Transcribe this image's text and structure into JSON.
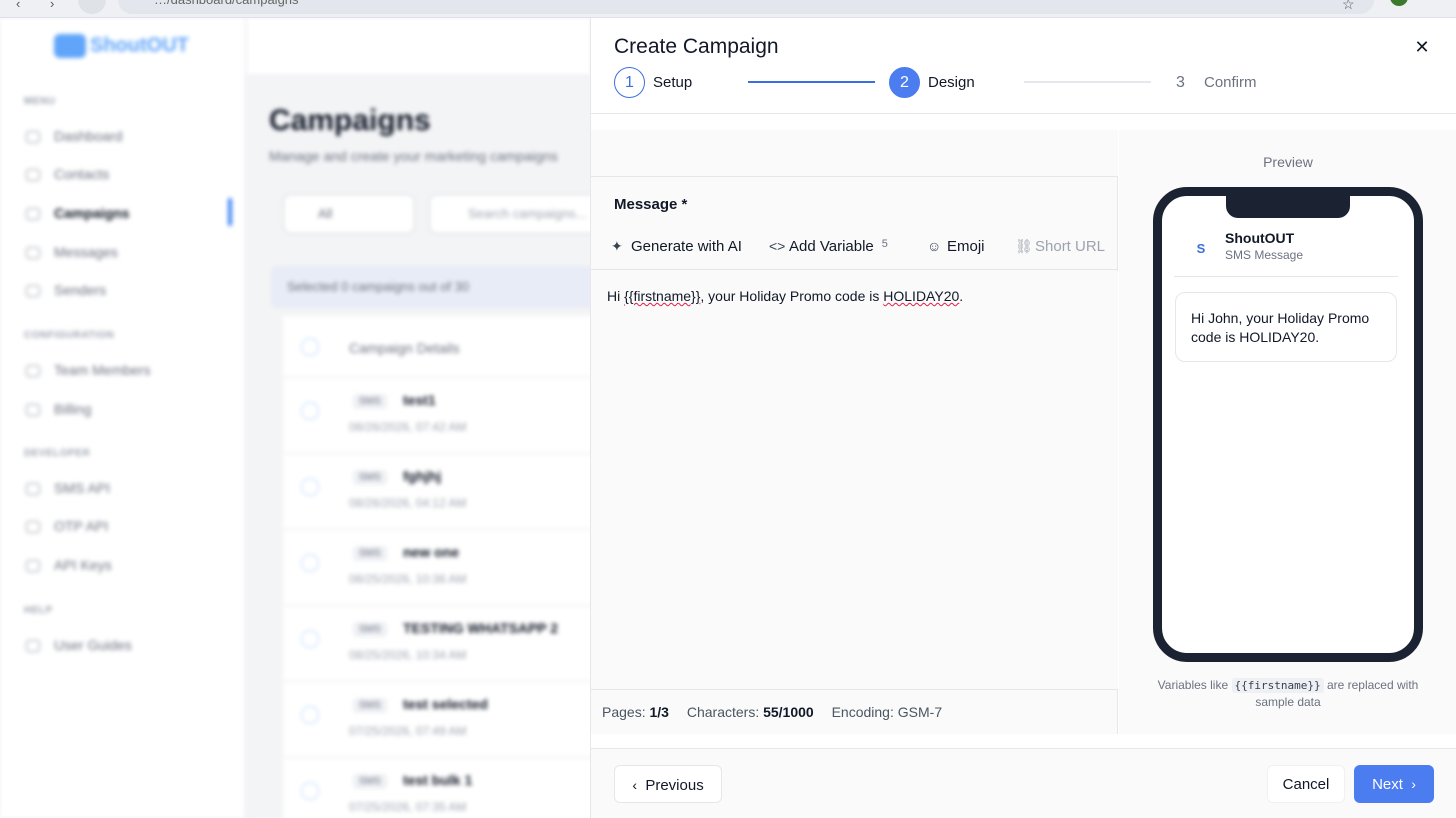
{
  "browser": {
    "url": "…/dashboard/campaigns"
  },
  "background": {
    "logo": "ShoutOUT",
    "sections": [
      "MENU",
      "CONFIGURATION",
      "DEVELOPER",
      "HELP"
    ],
    "nav": {
      "menu": [
        "Dashboard",
        "Contacts",
        "Campaigns",
        "Messages",
        "Senders"
      ],
      "configuration": [
        "Team Members",
        "Billing"
      ],
      "developer": [
        "SMS API",
        "OTP API",
        "API Keys"
      ],
      "help": [
        "User Guides"
      ]
    },
    "page_title": "Campaigns",
    "page_subtitle": "Manage and create your marketing campaigns",
    "filter_label": "All",
    "search_placeholder": "Search campaigns...",
    "selected_text": "Selected  0  campaigns out of 30",
    "table_header": "Campaign Details",
    "rows": [
      {
        "tag": "SMS",
        "name": "test1",
        "date": "08/26/2026, 07:42 AM"
      },
      {
        "tag": "SMS",
        "name": "fghjhj",
        "date": "08/26/2026, 04:12 AM"
      },
      {
        "tag": "SMS",
        "name": "new one",
        "date": "08/25/2026, 10:36 AM"
      },
      {
        "tag": "SMS",
        "name": "TESTING WHATSAPP 2",
        "date": "08/25/2026, 10:34 AM"
      },
      {
        "tag": "SMS",
        "name": "test selected",
        "date": "07/25/2026, 07:49 AM"
      },
      {
        "tag": "SMS",
        "name": "test bulk 1",
        "date": "07/25/2026, 07:35 AM"
      }
    ]
  },
  "modal": {
    "title": "Create Campaign",
    "close_icon": "close-icon",
    "steps": [
      {
        "number": "1",
        "label": "Setup",
        "state": "complete"
      },
      {
        "number": "2",
        "label": "Design",
        "state": "active"
      },
      {
        "number": "3",
        "label": "Confirm",
        "state": "pending"
      }
    ],
    "message_label": "Message *",
    "toolbar": {
      "generate_ai": "Generate with AI",
      "add_variable": "Add Variable",
      "variable_count": "5",
      "emoji": "Emoji",
      "short_url": "Short URL"
    },
    "message": {
      "prefix": "Hi ",
      "variable": "{{firstname}}",
      "middle": ", your Holiday Promo code is ",
      "code": "HOLIDAY20",
      "suffix": "."
    },
    "stats": {
      "pages_label": "Pages:",
      "pages_value": "1/3",
      "characters_label": "Characters:",
      "characters_value": "55/1000",
      "encoding_label": "Encoding:",
      "encoding_value": "GSM-7"
    },
    "preview": {
      "title": "Preview",
      "avatar_letter": "S",
      "sender_name": "ShoutOUT",
      "sender_type": "SMS Message",
      "bubble_text": "Hi John, your Holiday Promo code is HOLIDAY20.",
      "note_before": "Variables like",
      "note_code": "{{firstname}}",
      "note_after": "are replaced with sample data"
    },
    "footer": {
      "previous": "Previous",
      "cancel": "Cancel",
      "next": "Next"
    }
  },
  "colors": {
    "primary": "#4b7cf0",
    "primary_dark": "#3b6fe0",
    "phone_frame": "#1b2232",
    "spellcheck": "#e11d48"
  }
}
